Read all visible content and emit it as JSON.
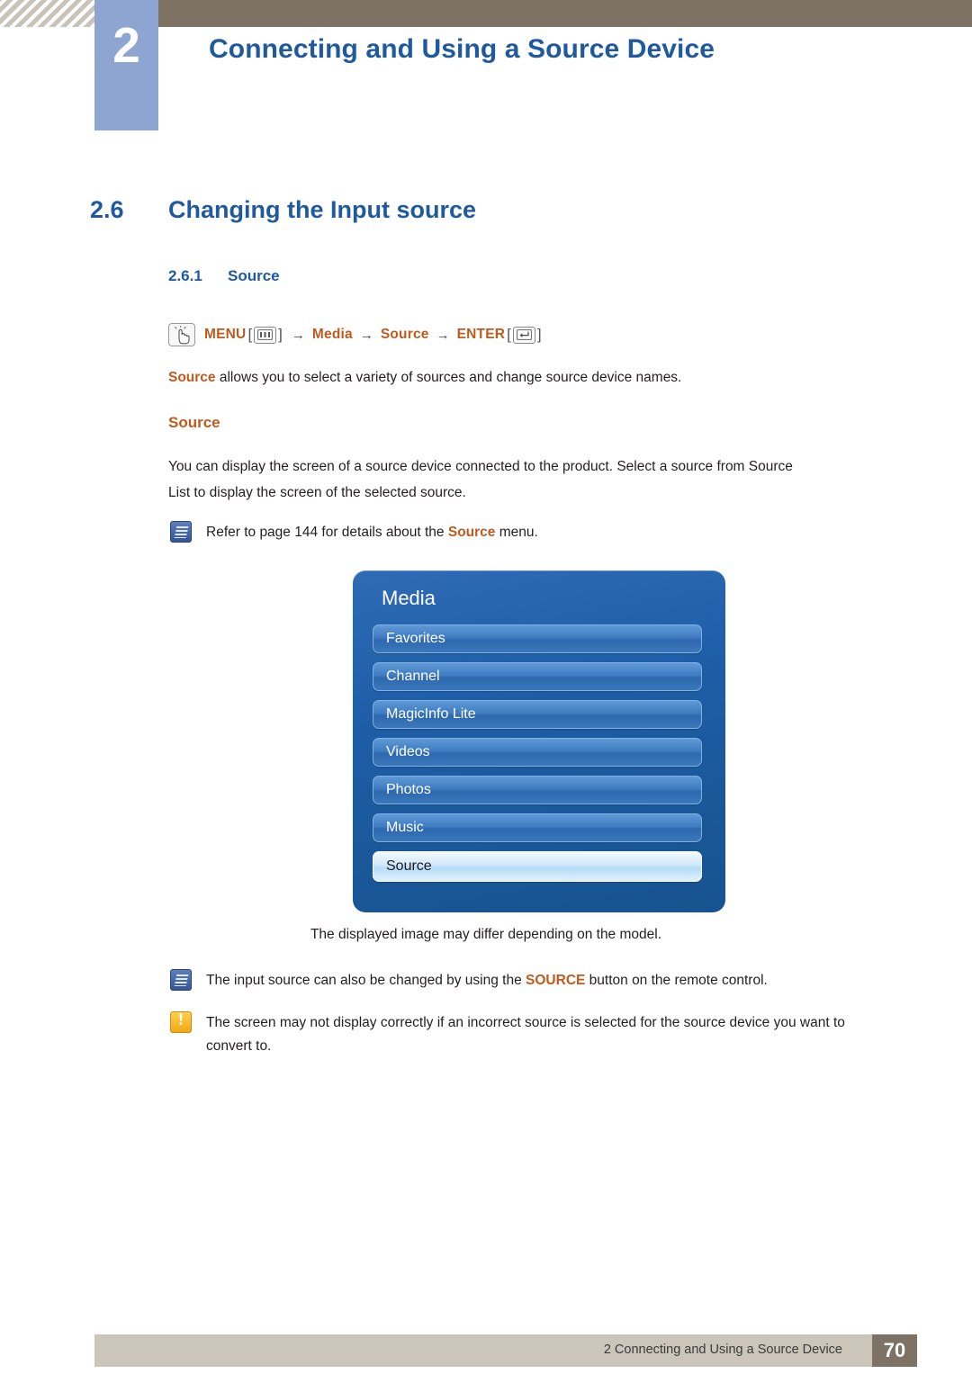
{
  "header": {
    "chapter_number": "2",
    "chapter_title": "Connecting and Using a Source Device"
  },
  "section": {
    "number": "2.6",
    "title": "Changing the Input source"
  },
  "subsection": {
    "number": "2.6.1",
    "title": "Source"
  },
  "menu_path": {
    "icon": "hand-press-icon",
    "menu_label": "MENU",
    "menu_key_icon": "menu-key-icon",
    "arrow": "→",
    "item1": "Media",
    "item2": "Source",
    "enter_label": "ENTER",
    "enter_key_icon": "enter-key-icon",
    "open_bracket": "[",
    "close_bracket": "]"
  },
  "intro": {
    "lead_word": "Source",
    "rest": " allows you to select a variety of sources and change source device names."
  },
  "subhead": "Source",
  "paragraph": {
    "line1": "You can display the screen of a source device connected to the product. Select a source from Source",
    "line2": "List to display the screen of the selected source."
  },
  "notes": [
    {
      "icon": "note-blue-icon",
      "pre": "Refer to page 144 for details about the ",
      "highlight": "Source",
      "post": " menu."
    },
    {
      "icon": "note-blue-icon",
      "pre": "The input source can also be changed by using the ",
      "highlight": "SOURCE",
      "post": " button on the remote control."
    },
    {
      "icon": "note-yellow-icon",
      "pre": "The screen may not display correctly if an incorrect source is selected for the source device you want to",
      "highlight": "",
      "post": "convert to."
    }
  ],
  "osd": {
    "title": "Media",
    "items": [
      {
        "label": "Favorites",
        "selected": false
      },
      {
        "label": "Channel",
        "selected": false
      },
      {
        "label": "MagicInfo Lite",
        "selected": false
      },
      {
        "label": "Videos",
        "selected": false
      },
      {
        "label": "Photos",
        "selected": false
      },
      {
        "label": "Music",
        "selected": false
      },
      {
        "label": "Source",
        "selected": true
      }
    ],
    "caption": "The displayed image may differ depending on the model."
  },
  "footer": {
    "text": "2 Connecting and Using a Source Device",
    "page": "70"
  },
  "colors": {
    "heading_blue": "#205a9e",
    "accent_orange": "#c05a1e",
    "header_brown": "#7d7264",
    "badge_blue": "#8da5d0",
    "footer_tan": "#ccc5ba"
  }
}
